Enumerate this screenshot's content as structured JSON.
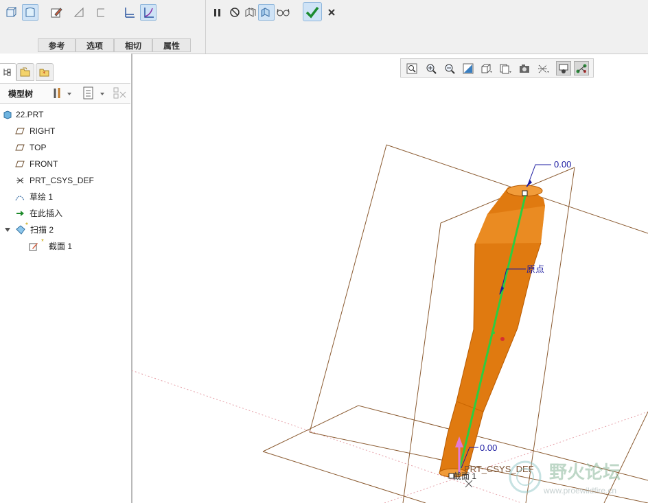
{
  "dashboard": {
    "tabs": [
      "参考",
      "选项",
      "相切",
      "属性"
    ],
    "icons": [
      "solid-icon",
      "surface-icon",
      "sketch-icon",
      "remove-material-icon",
      "thicken-icon",
      "constant-section-icon",
      "variable-section-icon",
      "pause-icon",
      "no-preview-icon",
      "verify-icon",
      "preview-icon",
      "glasses-icon",
      "ok-icon",
      "cancel-icon"
    ]
  },
  "panel_tabs": [
    "model-tree-tab-icon",
    "folder-browser-tab-icon",
    "favorites-tab-icon"
  ],
  "model_tree": {
    "title": "模型树",
    "items": [
      {
        "label": "22.PRT",
        "icon": "part-icon",
        "indent": 0
      },
      {
        "label": "RIGHT",
        "icon": "datum-plane-icon",
        "indent": 1
      },
      {
        "label": "TOP",
        "icon": "datum-plane-icon",
        "indent": 1
      },
      {
        "label": "FRONT",
        "icon": "datum-plane-icon",
        "indent": 1
      },
      {
        "label": "PRT_CSYS_DEF",
        "icon": "csys-icon",
        "indent": 1
      },
      {
        "label": "草绘 1",
        "icon": "sketch-curve-icon",
        "indent": 1
      },
      {
        "label": "在此插入",
        "icon": "insert-here-arrow-icon",
        "indent": 1
      },
      {
        "label": "扫描 2",
        "icon": "sweep-icon",
        "indent": 1,
        "expanded": true,
        "new": true
      },
      {
        "label": "截面 1",
        "icon": "section-sketch-icon",
        "indent": 2,
        "new": true
      }
    ]
  },
  "view_toolbar": {
    "icons": [
      "refit-icon",
      "zoom-in-icon",
      "zoom-out-icon",
      "repaint-icon",
      "display-style-icon",
      "saved-views-icon",
      "view-manager-icon",
      "datum-display-icon",
      "spin-center-icon",
      "annotation-display-icon"
    ]
  },
  "graphics": {
    "dim_top": "0.00",
    "dim_bottom": "0.00",
    "origin_label": "原点",
    "csys_label": "PRT_CSYS_DEF",
    "section_label": "截面 1",
    "watermark_text": "野火论坛",
    "watermark_url": "www.proewildfire.cn",
    "colors": {
      "model": "#e07a10",
      "trajectory": "#2ecc40",
      "datum": "#8a5a30",
      "dim": "#1a1aa0",
      "start_arrow": "#e27ad8"
    }
  }
}
